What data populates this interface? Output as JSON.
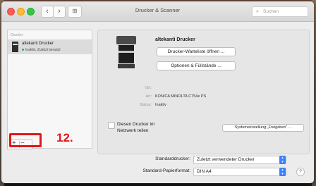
{
  "window": {
    "title": "Drucker & Scanner",
    "search_placeholder": "Suchen"
  },
  "sidebar": {
    "header": "Drucker",
    "items": [
      {
        "name": "altekanti Drucker",
        "status": "Inaktiv, Zuletzt benutzt"
      }
    ],
    "add_label": "+",
    "remove_label": "−"
  },
  "annotation": {
    "label": "12."
  },
  "detail": {
    "printer_name": "altekanti Drucker",
    "queue_button": "Drucker-Warteliste öffnen ...",
    "options_button": "Optionen & Füllstände ...",
    "info": {
      "ort_label": "Ort:",
      "ort_value": "",
      "art_label": "Art:",
      "art_value": "KONICA MINOLTA C754e PS",
      "status_label": "Status:",
      "status_value": "Inaktiv"
    },
    "share_label": "Diesen Drucker im Netzwerk teilen",
    "sharing_prefs_button": "Systemeinstellung „Freigaben“ ..."
  },
  "defaults": {
    "printer_label": "Standarddrucker:",
    "printer_value": "Zuletzt verwendeter Drucker",
    "paper_label": "Standard-Papierformat:",
    "paper_value": "DIN A4",
    "help": "?"
  },
  "colors": {
    "accent": "#3b82f6",
    "annotation": "#e21717"
  }
}
